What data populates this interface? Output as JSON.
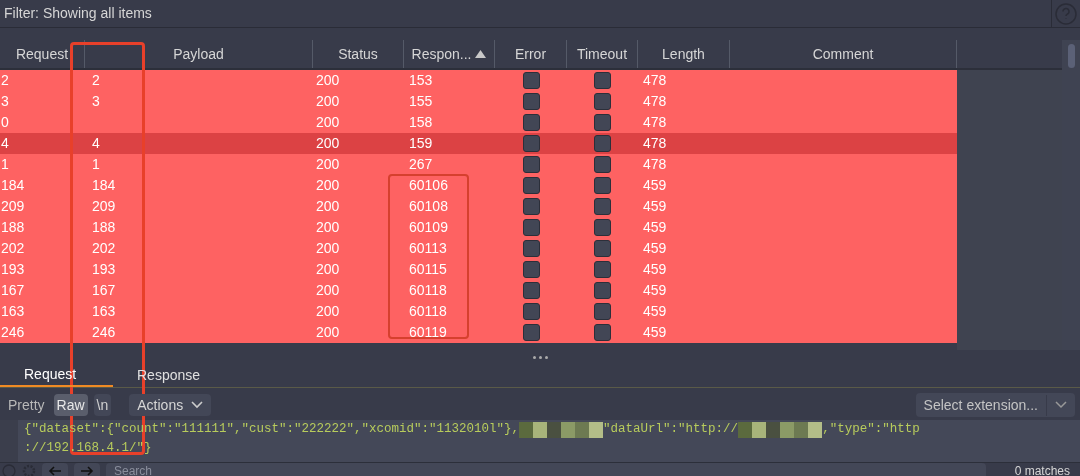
{
  "filter": {
    "label": "Filter: Showing all items"
  },
  "results_table": {
    "columns": [
      {
        "label": "Request",
        "sorted": false
      },
      {
        "label": "Payload",
        "sorted": false
      },
      {
        "label": "Status",
        "sorted": false
      },
      {
        "label": "Respon...",
        "sorted": true
      },
      {
        "label": "Error",
        "sorted": false
      },
      {
        "label": "Timeout",
        "sorted": false
      },
      {
        "label": "Length",
        "sorted": false
      },
      {
        "label": "Comment",
        "sorted": false
      }
    ],
    "rows": [
      {
        "request": "2",
        "payload": "2",
        "status": "200",
        "response": "153",
        "error": false,
        "timeout": false,
        "length": "478",
        "selected": false
      },
      {
        "request": "3",
        "payload": "3",
        "status": "200",
        "response": "155",
        "error": false,
        "timeout": false,
        "length": "478",
        "selected": false
      },
      {
        "request": "0",
        "status": "200",
        "response": "158",
        "error": false,
        "timeout": false,
        "length": "478",
        "selected": false
      },
      {
        "request": "4",
        "payload": "4",
        "status": "200",
        "response": "159",
        "error": false,
        "timeout": false,
        "length": "478",
        "selected": true
      },
      {
        "request": "1",
        "payload": "1",
        "status": "200",
        "response": "267",
        "error": false,
        "timeout": false,
        "length": "478",
        "selected": false
      },
      {
        "request": "184",
        "payload": "184",
        "status": "200",
        "response": "60106",
        "error": false,
        "timeout": false,
        "length": "459",
        "selected": false
      },
      {
        "request": "209",
        "payload": "209",
        "status": "200",
        "response": "60108",
        "error": false,
        "timeout": false,
        "length": "459",
        "selected": false
      },
      {
        "request": "188",
        "payload": "188",
        "status": "200",
        "response": "60109",
        "error": false,
        "timeout": false,
        "length": "459",
        "selected": false
      },
      {
        "request": "202",
        "payload": "202",
        "status": "200",
        "response": "60113",
        "error": false,
        "timeout": false,
        "length": "459",
        "selected": false
      },
      {
        "request": "193",
        "payload": "193",
        "status": "200",
        "response": "60115",
        "error": false,
        "timeout": false,
        "length": "459",
        "selected": false
      },
      {
        "request": "167",
        "payload": "167",
        "status": "200",
        "response": "60118",
        "error": false,
        "timeout": false,
        "length": "459",
        "selected": false
      },
      {
        "request": "163",
        "payload": "163",
        "status": "200",
        "response": "60118",
        "error": false,
        "timeout": false,
        "length": "459",
        "selected": false
      },
      {
        "request": "246",
        "payload": "246",
        "status": "200",
        "response": "60119",
        "error": false,
        "timeout": false,
        "length": "459",
        "selected": false
      }
    ]
  },
  "detail_tabs": [
    {
      "label": "Request",
      "selected": true
    },
    {
      "label": "Response",
      "selected": false
    }
  ],
  "view_buttons": [
    {
      "label": "Pretty",
      "selected": false
    },
    {
      "label": "Raw",
      "selected": true
    },
    {
      "label": "\\n",
      "selected": false
    }
  ],
  "actions_button": {
    "label": "Actions"
  },
  "extension_select": {
    "value": "Select extension..."
  },
  "editor": {
    "lines": [
      {
        "parts": [
          {
            "text": "{\"dataset\":{\"count\":\"111111\",\"cust\":\"222222\",\"xcomid\":\"1132010l\"},"
          },
          {
            "text": "\"dataUrl\":\"http://"
          },
          {
            "text": ",\"type\":\"http"
          }
        ]
      },
      {
        "parts": [
          {
            "text": "://192.168.4.1/\"}"
          }
        ]
      }
    ]
  },
  "search": {
    "placeholder": "Search",
    "matches": "0 matches"
  }
}
